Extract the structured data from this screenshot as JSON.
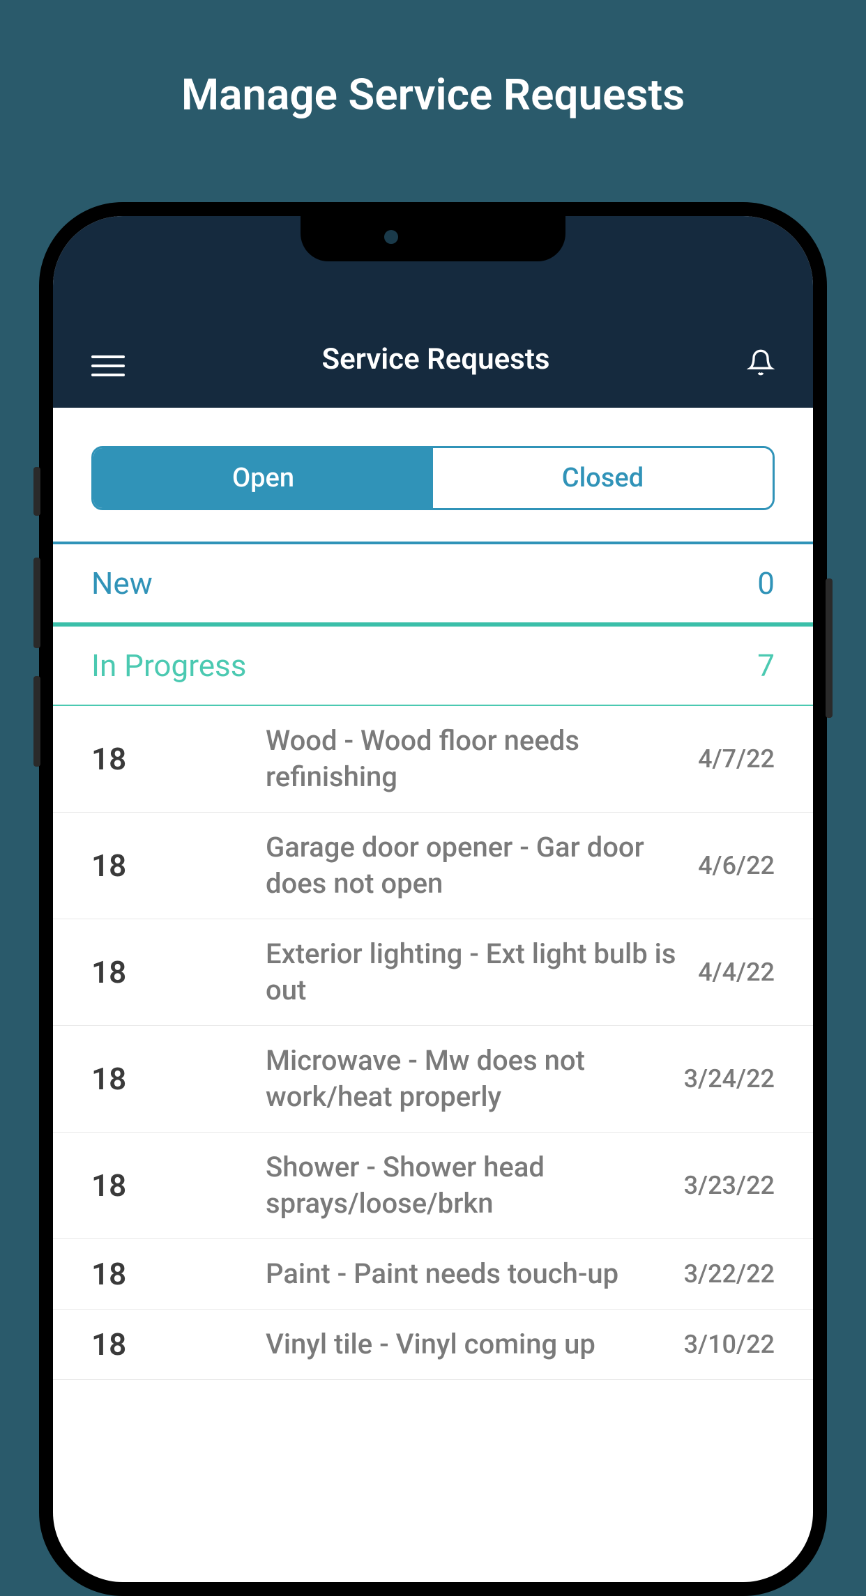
{
  "page_title": "Manage Service Requests",
  "header": {
    "title": "Service Requests"
  },
  "tabs": {
    "open": "Open",
    "closed": "Closed"
  },
  "sections": {
    "new": {
      "label": "New",
      "count": "0"
    },
    "in_progress": {
      "label": "In Progress",
      "count": "7"
    }
  },
  "requests": [
    {
      "id": "18",
      "description": "Wood - Wood floor needs refinishing",
      "date": "4/7/22"
    },
    {
      "id": "18",
      "description": "Garage door opener - Gar door does not open",
      "date": "4/6/22"
    },
    {
      "id": "18",
      "description": "Exterior lighting - Ext light bulb is out",
      "date": "4/4/22"
    },
    {
      "id": "18",
      "description": "Microwave - Mw does not work/heat properly",
      "date": "3/24/22"
    },
    {
      "id": "18",
      "description": "Shower - Shower head sprays/loose/brkn",
      "date": "3/23/22"
    },
    {
      "id": "18",
      "description": "Paint - Paint needs touch-up",
      "date": "3/22/22"
    },
    {
      "id": "18",
      "description": "Vinyl tile - Vinyl coming up",
      "date": "3/10/22"
    }
  ]
}
